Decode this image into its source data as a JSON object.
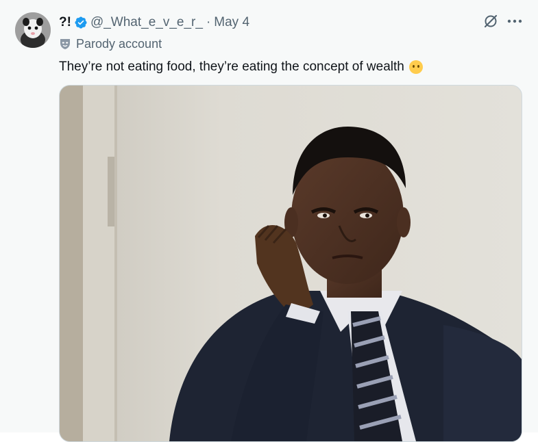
{
  "author": {
    "display_name": "?!",
    "handle": "@_What_e_v_e_r_",
    "separator": "·",
    "date": "May 4",
    "verified_icon": "verified-badge-icon",
    "avatar_icon": "possum-avatar"
  },
  "label": {
    "text": "Parody account",
    "icon": "mask-icon"
  },
  "tweet": {
    "text": "They’re not eating food, they’re eating the concept of wealth",
    "emoji": "face-without-mouth-emoji"
  },
  "actions": {
    "grok_icon": "grok-icon",
    "more_icon": "more-options-icon"
  },
  "media": {
    "type": "photo",
    "description_icon": "meme-photo"
  },
  "colors": {
    "verified": "#1d9bf0",
    "secondary_text": "#536471",
    "primary_text": "#0f1419"
  }
}
